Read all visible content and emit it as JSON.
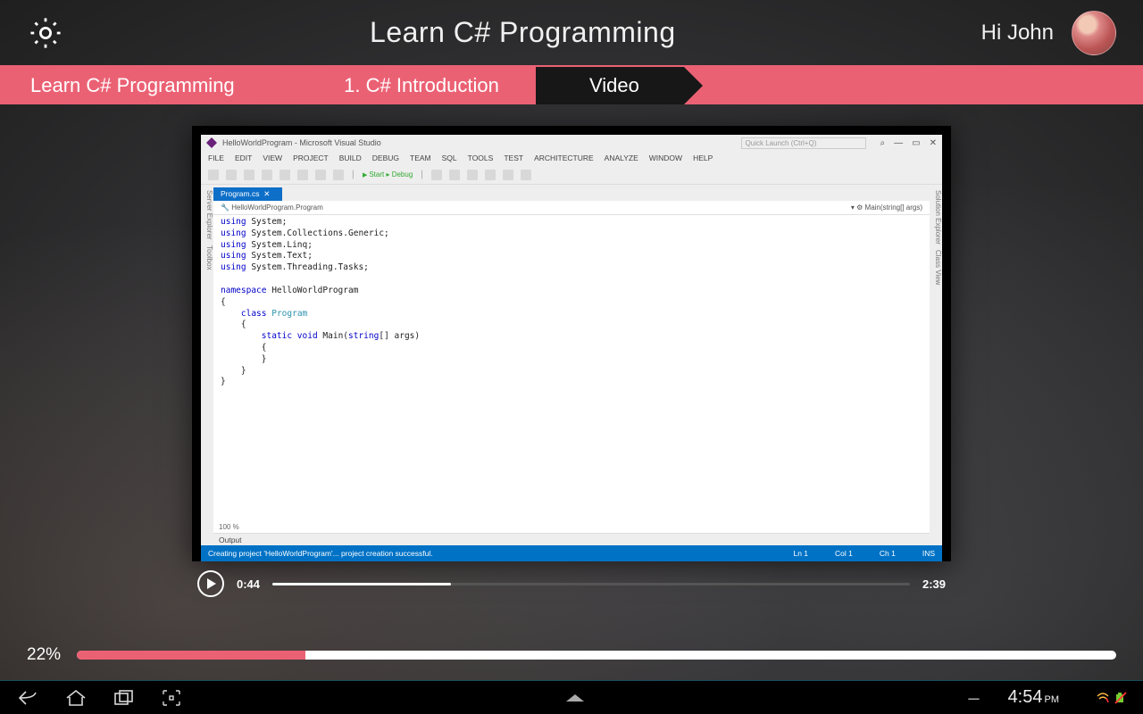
{
  "header": {
    "title": "Learn C# Programming",
    "greeting": "Hi John"
  },
  "breadcrumb": {
    "course": "Learn C# Programming",
    "chapter": "1. C# Introduction",
    "section": "Video"
  },
  "ide": {
    "window_title": "HelloWorldProgram - Microsoft Visual Studio",
    "quick_launch_placeholder": "Quick Launch (Ctrl+Q)",
    "menus": [
      "FILE",
      "EDIT",
      "VIEW",
      "PROJECT",
      "BUILD",
      "DEBUG",
      "TEAM",
      "SQL",
      "TOOLS",
      "TEST",
      "ARCHITECTURE",
      "ANALYZE",
      "WINDOW",
      "HELP"
    ],
    "toolbar_start": "Start",
    "toolbar_config": "Debug",
    "left_tabs": [
      "Server Explorer",
      "Toolbox"
    ],
    "right_tabs": [
      "Solution Explorer",
      "Class View"
    ],
    "file_tab": "Program.cs",
    "crumb_left": "HelloWorldProgram.Program",
    "crumb_right": "Main(string[] args)",
    "code": "using System;\nusing System.Collections.Generic;\nusing System.Linq;\nusing System.Text;\nusing System.Threading.Tasks;\n\nnamespace HelloWorldProgram\n{\n    class Program\n    {\n        static void Main(string[] args)\n        {\n        }\n    }\n}",
    "zoom": "100 %",
    "output_header": "Output",
    "status_msg": "Creating project 'HelloWorldProgram'... project creation successful.",
    "status_ln": "Ln 1",
    "status_col": "Col 1",
    "status_ch": "Ch 1",
    "status_ins": "INS"
  },
  "player": {
    "current": "0:44",
    "duration": "2:39",
    "progress_pct": 28
  },
  "course_progress": {
    "label": "22%",
    "pct": 22
  },
  "android": {
    "time": "4:54",
    "ampm": "PM"
  },
  "colors": {
    "accent": "#eb6174",
    "vs_blue": "#0072c6"
  }
}
